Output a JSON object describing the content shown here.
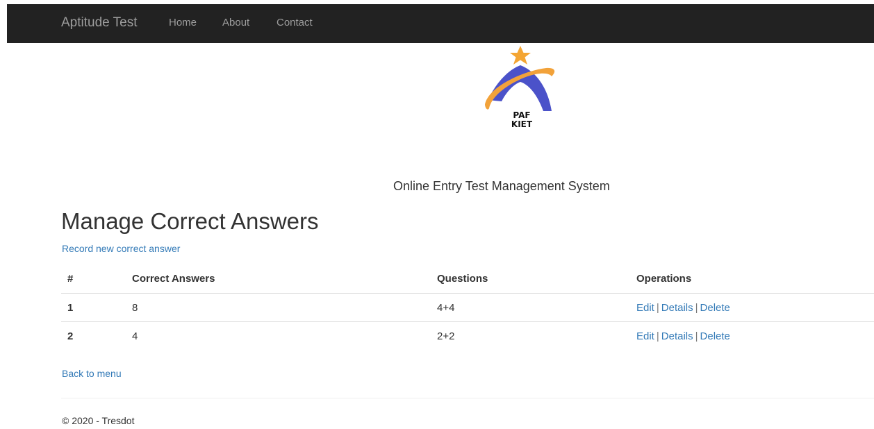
{
  "navbar": {
    "brand": "Aptitude Test",
    "items": [
      {
        "label": "Home"
      },
      {
        "label": "About"
      },
      {
        "label": "Contact"
      }
    ],
    "background": "#222222",
    "text_color": "#9d9d9d"
  },
  "logo": {
    "line1": "PAF",
    "line2": "KIET",
    "colors": {
      "arch": "#4b52c9",
      "swoosh": "#f2a23a",
      "star": "#f4a533"
    }
  },
  "subtitle": "Online Entry Test Management System",
  "page_title": "Manage Correct Answers",
  "create_link": "Record new correct answer",
  "table": {
    "headers": [
      "#",
      "Correct Answers",
      "Questions",
      "Operations"
    ],
    "rows": [
      {
        "num": "1",
        "answer": "8",
        "question": "4+4",
        "ops": [
          "Edit",
          "Details",
          "Delete"
        ]
      },
      {
        "num": "2",
        "answer": "4",
        "question": "2+2",
        "ops": [
          "Edit",
          "Details",
          "Delete"
        ]
      }
    ],
    "separator": "|"
  },
  "back_link": "Back to menu",
  "footer": "© 2020 - Tresdot",
  "link_color": "#337ab7"
}
